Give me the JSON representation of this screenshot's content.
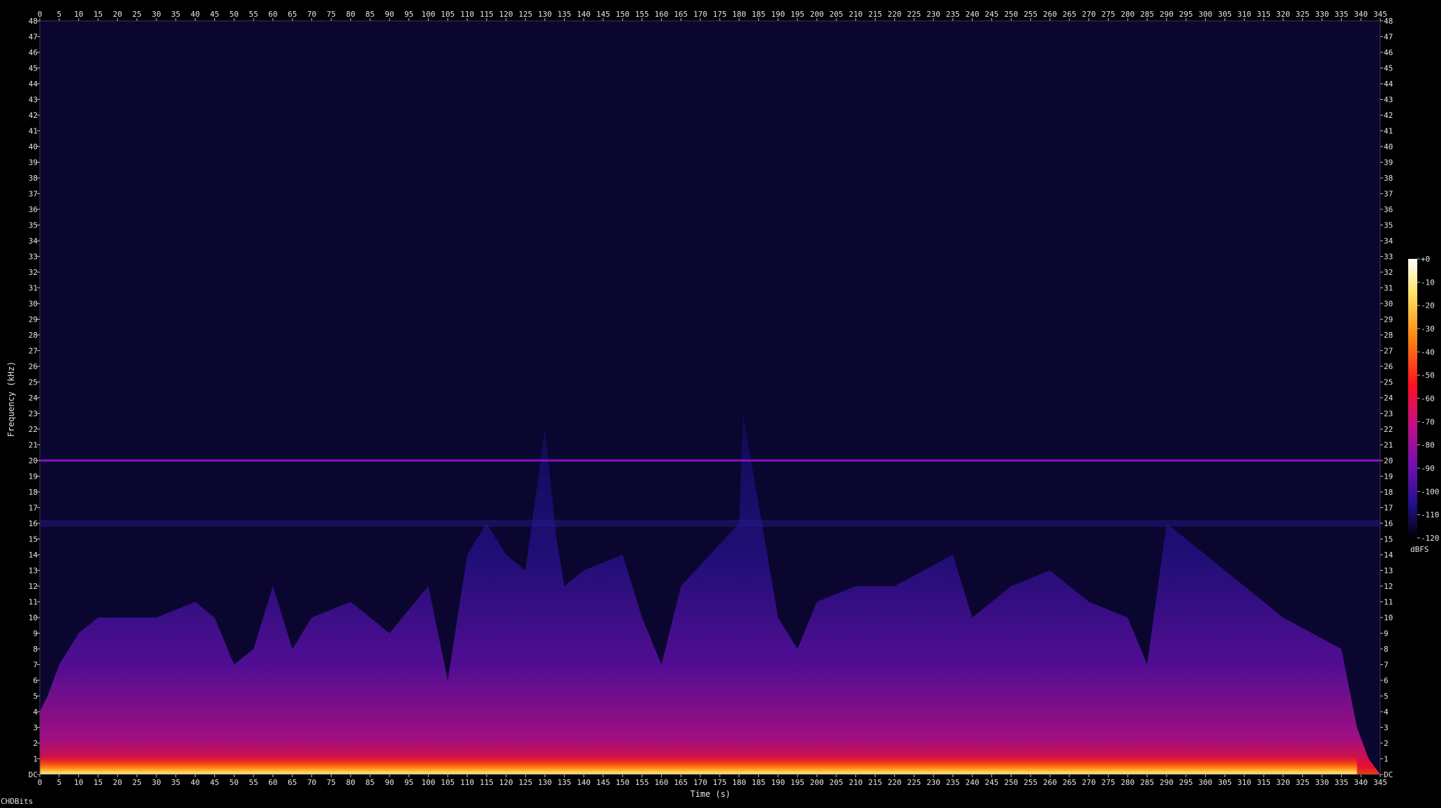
{
  "chart_data": {
    "type": "heatmap",
    "xlabel": "Time (s)",
    "ylabel": "Frequency (kHz)",
    "x_ticks": [
      0,
      5,
      10,
      15,
      20,
      25,
      30,
      35,
      40,
      45,
      50,
      55,
      60,
      65,
      70,
      75,
      80,
      85,
      90,
      95,
      100,
      105,
      110,
      115,
      120,
      125,
      130,
      135,
      140,
      145,
      150,
      155,
      160,
      165,
      170,
      175,
      180,
      185,
      190,
      195,
      200,
      205,
      210,
      215,
      220,
      225,
      230,
      235,
      240,
      245,
      250,
      255,
      260,
      265,
      270,
      275,
      280,
      285,
      290,
      295,
      300,
      305,
      310,
      315,
      320,
      325,
      330,
      335,
      340,
      345
    ],
    "y_ticks": [
      "DC",
      "1",
      "2",
      "3",
      "4",
      "5",
      "6",
      "7",
      "8",
      "9",
      "10",
      "11",
      "12",
      "13",
      "14",
      "15",
      "16",
      "17",
      "18",
      "19",
      "20",
      "21",
      "22",
      "23",
      "24",
      "25",
      "26",
      "27",
      "28",
      "29",
      "30",
      "31",
      "32",
      "33",
      "34",
      "35",
      "36",
      "37",
      "38",
      "39",
      "40",
      "41",
      "42",
      "43",
      "44",
      "45",
      "46",
      "47",
      "48"
    ],
    "xlim": [
      0,
      345
    ],
    "ylim": [
      0,
      48
    ],
    "colorbar": {
      "unit": "dBFS",
      "ticks": [
        "+0",
        "-10",
        "-20",
        "-30",
        "-40",
        "-50",
        "-60",
        "-70",
        "-80",
        "-90",
        "-100",
        "-110",
        "-120"
      ],
      "range": [
        -120,
        0
      ]
    },
    "energy_envelope": {
      "t": [
        0,
        2,
        5,
        10,
        15,
        20,
        30,
        40,
        45,
        50,
        55,
        60,
        65,
        70,
        80,
        90,
        100,
        105,
        110,
        115,
        120,
        125,
        130,
        133,
        135,
        140,
        150,
        155,
        160,
        165,
        180,
        181,
        190,
        195,
        200,
        210,
        220,
        235,
        240,
        250,
        260,
        270,
        280,
        285,
        290,
        300,
        305,
        310,
        320,
        335,
        339,
        342,
        345
      ],
      "fmax_khz": [
        4,
        5,
        7,
        9,
        10,
        10,
        10,
        11,
        10,
        7,
        8,
        12,
        8,
        10,
        11,
        9,
        12,
        6,
        14,
        16,
        14,
        13,
        22,
        15,
        12,
        13,
        14,
        10,
        7,
        12,
        16,
        23,
        10,
        8,
        11,
        12,
        12,
        14,
        10,
        12,
        13,
        11,
        10,
        7,
        16,
        14,
        13,
        12,
        10,
        8,
        3,
        1,
        0
      ]
    },
    "tonal_line_khz": 20,
    "faint_band_khz": 16
  },
  "footer_text": "CHDBits",
  "colors": {
    "background": "#000000",
    "floor": "#0a0630",
    "ridge": "#8a12c4",
    "hot": "#ff2a00",
    "peak": "#fff6a0"
  }
}
